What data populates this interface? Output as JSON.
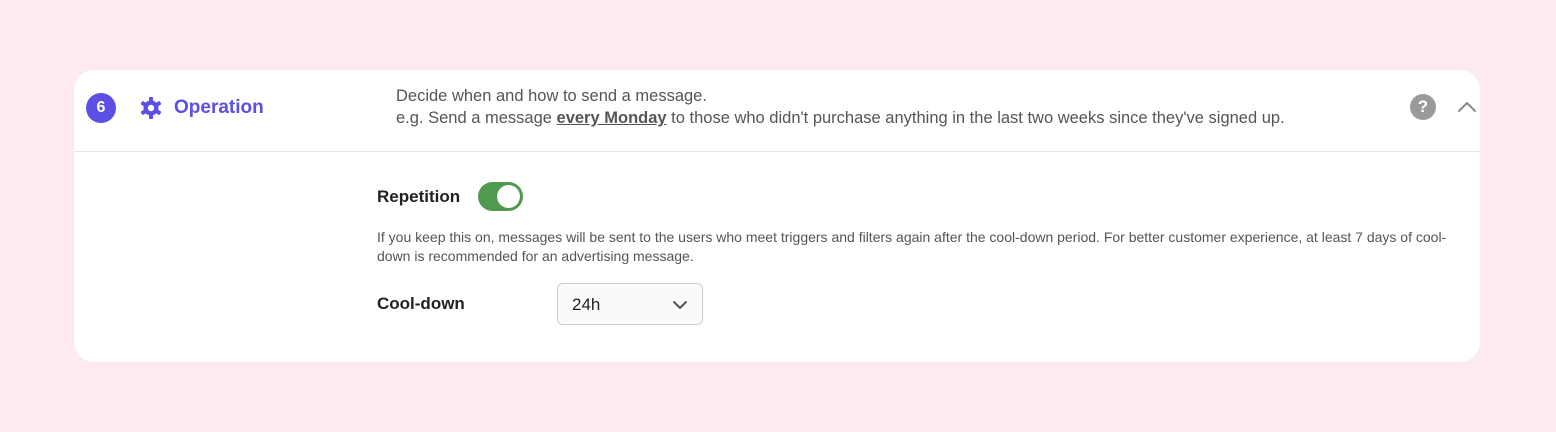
{
  "section": {
    "step_number": "6",
    "title": "Operation",
    "icon": "gear-icon",
    "accent_color": "#5b4fe4",
    "description_line1": "Decide when and how to send a message.",
    "description_line2_prefix": "e.g. Send a message ",
    "description_line2_emphasis": "every Monday",
    "description_line2_suffix": " to those who didn't purchase anything in the last two weeks since they've signed up.",
    "help_label": "?"
  },
  "repetition": {
    "label": "Repetition",
    "enabled": true,
    "toggle_color": "#4f9a4f",
    "help_text": "If you keep this on, messages will be sent to the users who meet triggers and filters again after the cool-down period. For better customer experience, at least 7 days of cool-down is recommended for an advertising message."
  },
  "cooldown": {
    "label": "Cool-down",
    "selected_value": "24h"
  }
}
